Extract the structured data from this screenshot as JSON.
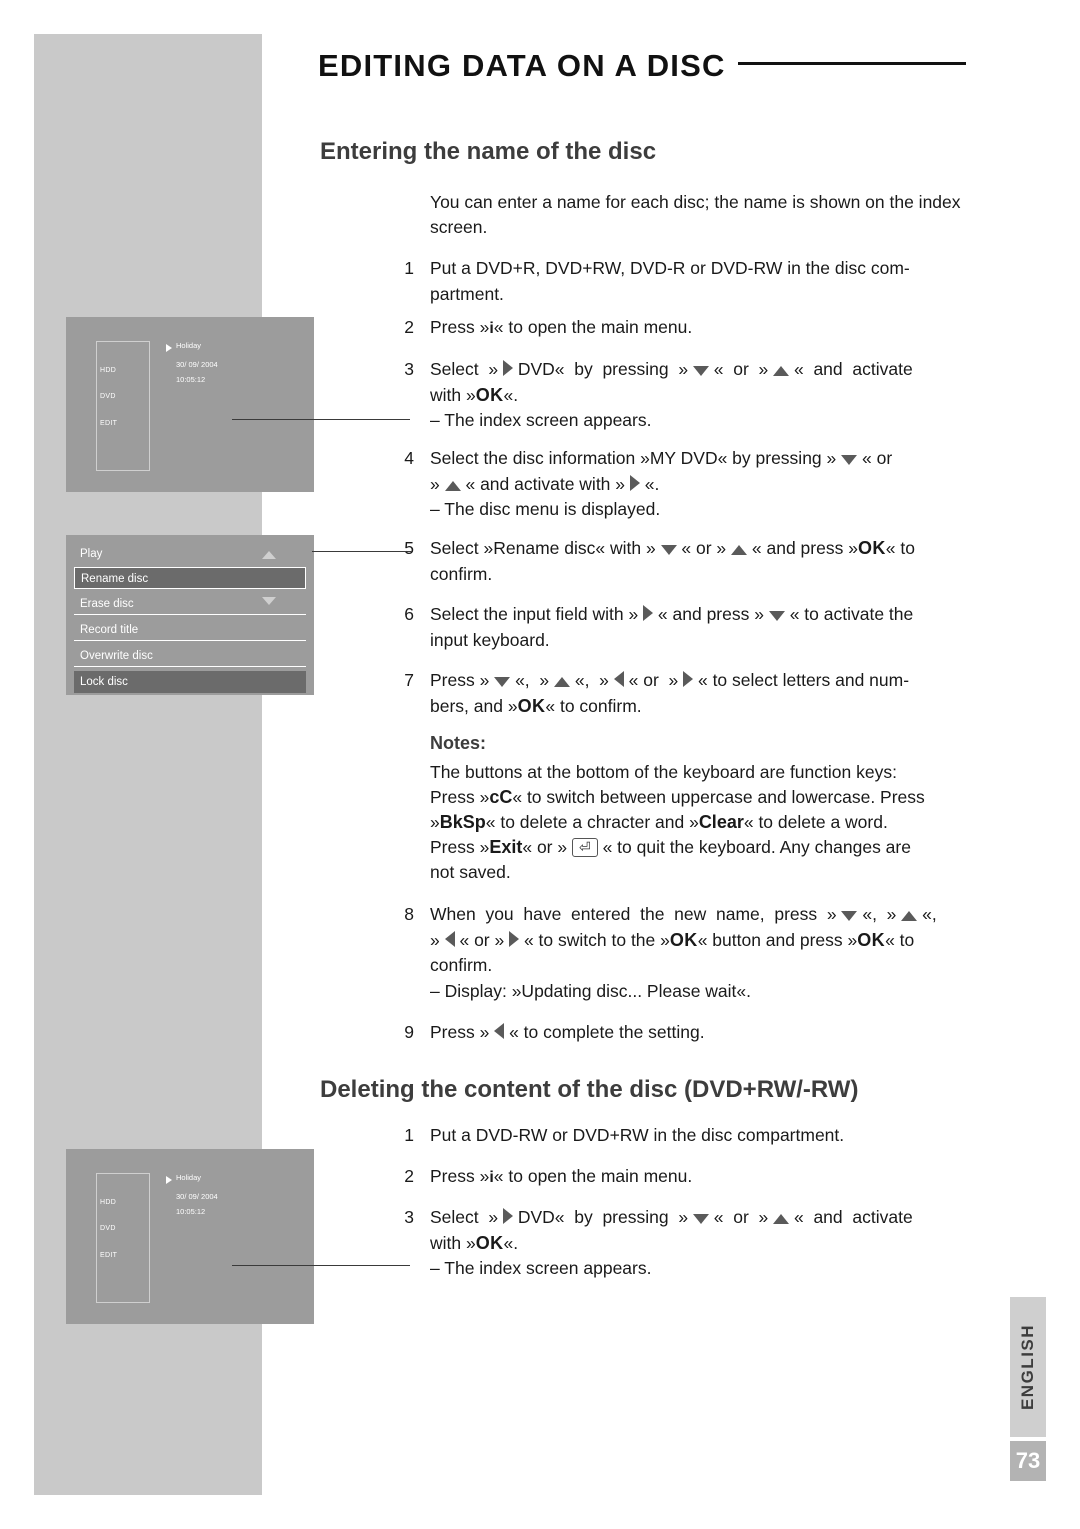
{
  "header": {
    "title": "EDITING DATA ON A DISC"
  },
  "sections": {
    "entering_name": {
      "title": "Entering the name of the disc",
      "intro": "You can enter a name for each disc; the name is shown on the index screen.",
      "steps": [
        {
          "num": "1",
          "text": "Put a DVD+R, DVD+RW, DVD-R or DVD-RW in the disc compartment."
        },
        {
          "num": "2",
          "text": "Press »i« to open the main menu."
        },
        {
          "num": "3",
          "text": "Select » ▶ DVD« by pressing » ▼ « or » ▲ « and activate with »OK«.",
          "sub": "– The index screen appears."
        },
        {
          "num": "4",
          "text": "Select the disc information »MY DVD« by pressing » ▼ « or » ▲ « and activate with » ▶ «.",
          "sub": "– The disc menu is displayed."
        },
        {
          "num": "5",
          "text": "Select »Rename disc« with » ▼ « or » ▲ « and press »OK« to confirm."
        },
        {
          "num": "6",
          "text": "Select the input field with » ▶ « and press » ▼ « to activate the input keyboard."
        },
        {
          "num": "7",
          "text": "Press » ▼ «, » ▲ «, » ◀ « or » ▶ « to select letters and numbers, and »OK« to confirm."
        },
        {
          "num": "8",
          "text": "When you have entered the new name, press » ▼ «, » ▲ «, » ◀ « or » ▶ « to switch to the »OK« button and press »OK« to confirm.",
          "sub": "– Display: »Updating disc... Please wait«."
        },
        {
          "num": "9",
          "text": "Press » ◀ « to complete the setting."
        }
      ],
      "notes_title": "Notes:",
      "notes": [
        "The buttons at the bottom of the keyboard are function keys:",
        "Press »cC« to switch between uppercase and lowercase. Press »BkSp« to delete a chracter and »Clear« to delete a word.",
        "Press »Exit« or » ⏎ « to quit the keyboard. Any changes are not saved."
      ]
    },
    "deleting_content": {
      "title": "Deleting the content of the disc (DVD+RW/-RW)",
      "steps": [
        {
          "num": "1",
          "text": "Put a DVD-RW or DVD+RW in the disc compartment."
        },
        {
          "num": "2",
          "text": "Press »i« to open the main menu."
        },
        {
          "num": "3",
          "text": "Select » ▶ DVD« by pressing » ▼ « or » ▲ « and activate with »OK«.",
          "sub": "– The index screen appears."
        }
      ]
    }
  },
  "figures": {
    "index_screen_top": {
      "column_labels": [
        "HDD",
        "DVD",
        "EDIT"
      ],
      "title": "Holiday",
      "date": "30/ 09/ 2004",
      "time": "10:05:12"
    },
    "disc_menu": {
      "items": [
        {
          "label": "Play",
          "selected": false
        },
        {
          "label": "Rename disc",
          "selected": true
        },
        {
          "label": "Erase disc",
          "selected": false
        },
        {
          "label": "Record title",
          "selected": false
        },
        {
          "label": "Overwrite disc",
          "selected": false
        },
        {
          "label": "Lock disc",
          "selected": false
        }
      ]
    },
    "index_screen_bottom": {
      "column_labels": [
        "HDD",
        "DVD",
        "EDIT"
      ],
      "title": "Holiday",
      "date": "30/ 09/ 2004",
      "time": "10:05:12"
    }
  },
  "footer": {
    "language": "ENGLISH",
    "page_number": "73"
  }
}
